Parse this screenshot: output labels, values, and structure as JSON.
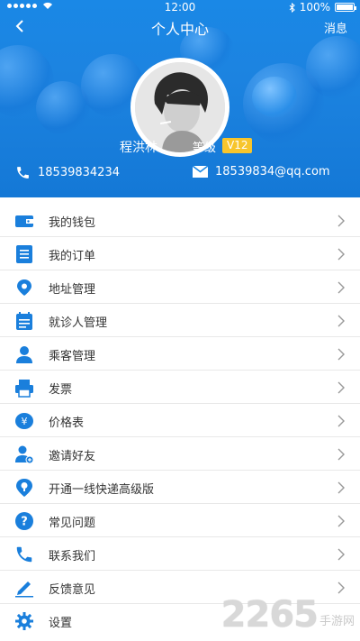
{
  "status_bar": {
    "time": "12:00",
    "battery": "100%"
  },
  "nav": {
    "title": "个人中心",
    "message": "消息"
  },
  "profile": {
    "name": "程洪林",
    "level_label": "等级",
    "vip": "V12",
    "phone": "18539834234",
    "email": "18539834@qq.com"
  },
  "menu": [
    {
      "label": "我的钱包",
      "icon": "wallet-icon"
    },
    {
      "label": "我的订单",
      "icon": "order-list-icon"
    },
    {
      "label": "地址管理",
      "icon": "location-icon"
    },
    {
      "label": "就诊人管理",
      "icon": "calendar-icon"
    },
    {
      "label": "乘客管理",
      "icon": "person-icon"
    },
    {
      "label": "发票",
      "icon": "printer-icon"
    },
    {
      "label": "价格表",
      "icon": "yuan-icon"
    },
    {
      "label": "邀请好友",
      "icon": "add-friend-icon"
    },
    {
      "label": "开通一线快递高级版",
      "icon": "premium-pin-icon"
    },
    {
      "label": "常见问题",
      "icon": "question-icon"
    },
    {
      "label": "联系我们",
      "icon": "phone-icon"
    },
    {
      "label": "反馈意见",
      "icon": "pencil-icon"
    },
    {
      "label": "设置",
      "icon": "gear-icon"
    }
  ],
  "watermark": {
    "number": "2265",
    "suffix": "手游网"
  },
  "colors": {
    "primary": "#1a88e6",
    "vip": "#f7c52c",
    "icon": "#1a7fdc"
  }
}
